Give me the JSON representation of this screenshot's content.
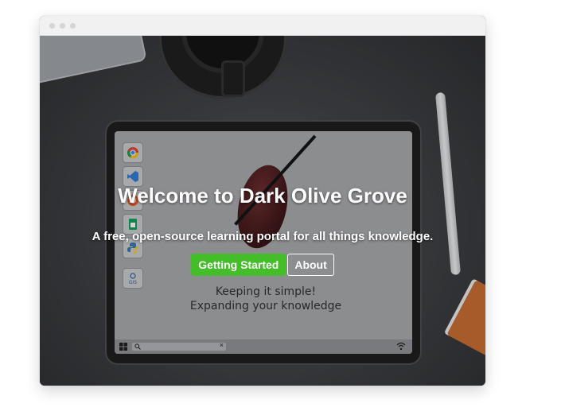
{
  "hero": {
    "title": "Welcome to Dark Olive Grove",
    "subtitle": "A free, open-source learning portal for all things knowledge.",
    "primary_button": "Getting Started",
    "secondary_button": "About"
  },
  "tablet_screen": {
    "line1": "Keeping it simple!",
    "line2": "Expanding your knowledge",
    "taskbar_search_close": "×"
  },
  "colors": {
    "accent_green": "#43be28",
    "text": "#ffffff"
  },
  "icons": [
    "chrome-icon",
    "vscode-icon",
    "ubuntu-icon",
    "sheets-icon",
    "python-icon",
    "gis-icon",
    "windows-icon",
    "search-icon",
    "wifi-icon"
  ]
}
